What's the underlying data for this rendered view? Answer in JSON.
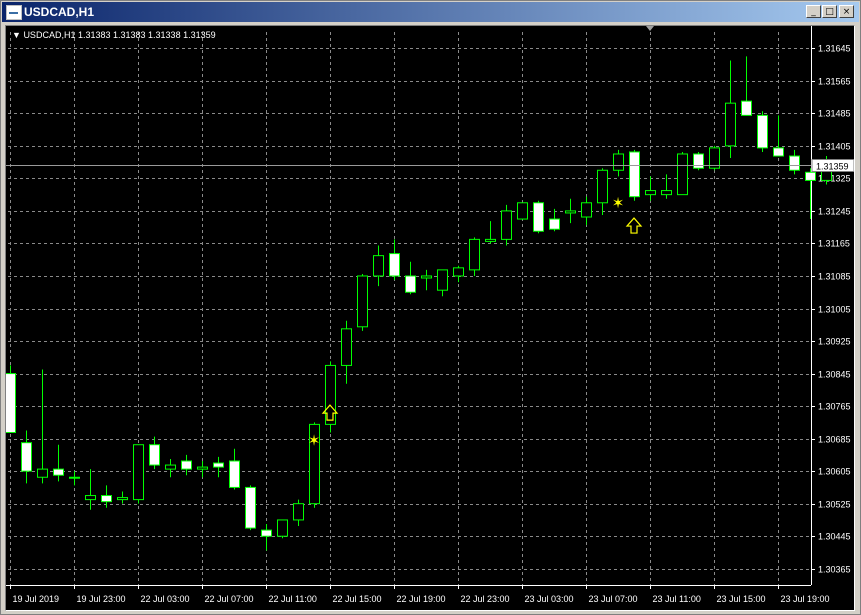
{
  "window": {
    "title": "USDCAD,H1",
    "minimize_glyph": "_",
    "restore_glyph": "□",
    "close_glyph": "×"
  },
  "chart_header": {
    "arrow_glyph": "▼",
    "symbol": "USDCAD,H1",
    "ohlc": "1.31383 1.31383 1.31338 1.31359"
  },
  "colors": {
    "background": "#000000",
    "grid": "#8a8a8a",
    "bull_outline": "#00ff00",
    "bear_fill": "#ffffff",
    "wick": "#00ff00",
    "signal": "#ffff00",
    "axis_text": "#ffffff",
    "price_line": "#9a9a9a"
  },
  "chart_data": {
    "type": "candlestick",
    "symbol": "USDCAD",
    "timeframe": "H1",
    "ylim": [
      1.31365,
      1.30365
    ],
    "y_axis_note": "prices shown on right axis",
    "y_ticks": [
      "1.31645",
      "1.31565",
      "1.31485",
      "1.31405",
      "1.31325",
      "1.31245",
      "1.31165",
      "1.31085",
      "1.31005",
      "1.30925",
      "1.30845",
      "1.30765",
      "1.30685",
      "1.30605",
      "1.30525",
      "1.30445",
      "1.30365"
    ],
    "x_ticks": [
      "19 Jul 2019",
      "19 Jul 23:00",
      "22 Jul 03:00",
      "22 Jul 07:00",
      "22 Jul 11:00",
      "22 Jul 15:00",
      "22 Jul 19:00",
      "22 Jul 23:00",
      "23 Jul 03:00",
      "23 Jul 07:00",
      "23 Jul 11:00",
      "23 Jul 15:00",
      "23 Jul 19:00"
    ],
    "current_price": "1.31359",
    "candles": [
      {
        "o": 1.30845,
        "h": 1.30865,
        "l": 1.307,
        "c": 1.307
      },
      {
        "o": 1.30675,
        "h": 1.30705,
        "l": 1.30575,
        "c": 1.30605
      },
      {
        "o": 1.3059,
        "h": 1.30855,
        "l": 1.30575,
        "c": 1.3061
      },
      {
        "o": 1.3061,
        "h": 1.3067,
        "l": 1.3058,
        "c": 1.30595
      },
      {
        "o": 1.3059,
        "h": 1.30605,
        "l": 1.3057,
        "c": 1.3059
      },
      {
        "o": 1.30535,
        "h": 1.3061,
        "l": 1.3051,
        "c": 1.30545
      },
      {
        "o": 1.30545,
        "h": 1.3057,
        "l": 1.30515,
        "c": 1.3053
      },
      {
        "o": 1.30535,
        "h": 1.30555,
        "l": 1.30525,
        "c": 1.3054
      },
      {
        "o": 1.30535,
        "h": 1.3067,
        "l": 1.30525,
        "c": 1.3067
      },
      {
        "o": 1.3067,
        "h": 1.3069,
        "l": 1.3061,
        "c": 1.3062
      },
      {
        "o": 1.3061,
        "h": 1.30635,
        "l": 1.3059,
        "c": 1.3062
      },
      {
        "o": 1.3063,
        "h": 1.30645,
        "l": 1.30595,
        "c": 1.3061
      },
      {
        "o": 1.3061,
        "h": 1.3063,
        "l": 1.3059,
        "c": 1.30615
      },
      {
        "o": 1.30625,
        "h": 1.3064,
        "l": 1.3059,
        "c": 1.30615
      },
      {
        "o": 1.3063,
        "h": 1.3066,
        "l": 1.3056,
        "c": 1.30565
      },
      {
        "o": 1.30565,
        "h": 1.3057,
        "l": 1.3046,
        "c": 1.30465
      },
      {
        "o": 1.3046,
        "h": 1.30475,
        "l": 1.3041,
        "c": 1.30445
      },
      {
        "o": 1.30445,
        "h": 1.30485,
        "l": 1.3044,
        "c": 1.30485
      },
      {
        "o": 1.30485,
        "h": 1.30535,
        "l": 1.3047,
        "c": 1.30525
      },
      {
        "o": 1.30525,
        "h": 1.30725,
        "l": 1.30515,
        "c": 1.3072
      },
      {
        "o": 1.3072,
        "h": 1.30875,
        "l": 1.307,
        "c": 1.30865
      },
      {
        "o": 1.30865,
        "h": 1.30975,
        "l": 1.3082,
        "c": 1.30955
      },
      {
        "o": 1.3096,
        "h": 1.3109,
        "l": 1.3095,
        "c": 1.31085
      },
      {
        "o": 1.31085,
        "h": 1.3116,
        "l": 1.3106,
        "c": 1.31135
      },
      {
        "o": 1.3114,
        "h": 1.31175,
        "l": 1.31075,
        "c": 1.31085
      },
      {
        "o": 1.31085,
        "h": 1.3112,
        "l": 1.3104,
        "c": 1.31045
      },
      {
        "o": 1.3108,
        "h": 1.311,
        "l": 1.3105,
        "c": 1.31085
      },
      {
        "o": 1.3105,
        "h": 1.311,
        "l": 1.31035,
        "c": 1.311
      },
      {
        "o": 1.31085,
        "h": 1.3111,
        "l": 1.3107,
        "c": 1.31105
      },
      {
        "o": 1.311,
        "h": 1.3118,
        "l": 1.31085,
        "c": 1.31175
      },
      {
        "o": 1.3117,
        "h": 1.3122,
        "l": 1.31165,
        "c": 1.31175
      },
      {
        "o": 1.31175,
        "h": 1.3126,
        "l": 1.3116,
        "c": 1.31245
      },
      {
        "o": 1.31225,
        "h": 1.31265,
        "l": 1.31225,
        "c": 1.31265
      },
      {
        "o": 1.31265,
        "h": 1.3127,
        "l": 1.3119,
        "c": 1.31195
      },
      {
        "o": 1.31225,
        "h": 1.3125,
        "l": 1.31195,
        "c": 1.312
      },
      {
        "o": 1.3124,
        "h": 1.31275,
        "l": 1.31215,
        "c": 1.31245
      },
      {
        "o": 1.3123,
        "h": 1.3128,
        "l": 1.3121,
        "c": 1.31265
      },
      {
        "o": 1.31265,
        "h": 1.3135,
        "l": 1.31235,
        "c": 1.31345
      },
      {
        "o": 1.31345,
        "h": 1.31395,
        "l": 1.3133,
        "c": 1.31385
      },
      {
        "o": 1.3139,
        "h": 1.31395,
        "l": 1.3127,
        "c": 1.3128
      },
      {
        "o": 1.31285,
        "h": 1.3133,
        "l": 1.3127,
        "c": 1.31295
      },
      {
        "o": 1.31285,
        "h": 1.31335,
        "l": 1.31275,
        "c": 1.31295
      },
      {
        "o": 1.31285,
        "h": 1.3139,
        "l": 1.31285,
        "c": 1.31385
      },
      {
        "o": 1.31385,
        "h": 1.3139,
        "l": 1.31345,
        "c": 1.3135
      },
      {
        "o": 1.3135,
        "h": 1.31405,
        "l": 1.31345,
        "c": 1.314
      },
      {
        "o": 1.31405,
        "h": 1.31615,
        "l": 1.31375,
        "c": 1.3151
      },
      {
        "o": 1.31515,
        "h": 1.31625,
        "l": 1.31485,
        "c": 1.3148
      },
      {
        "o": 1.3148,
        "h": 1.3149,
        "l": 1.3139,
        "c": 1.314
      },
      {
        "o": 1.314,
        "h": 1.3148,
        "l": 1.31385,
        "c": 1.3138
      },
      {
        "o": 1.3138,
        "h": 1.31395,
        "l": 1.31335,
        "c": 1.31345
      },
      {
        "o": 1.3134,
        "h": 1.3135,
        "l": 1.31225,
        "c": 1.3132
      },
      {
        "o": 1.3132,
        "h": 1.3138,
        "l": 1.3131,
        "c": 1.3135
      }
    ],
    "signals": [
      {
        "type": "star",
        "index": 19,
        "price": 1.3068
      },
      {
        "type": "up-arrow",
        "index": 20,
        "price": 1.30765
      },
      {
        "type": "star",
        "index": 38,
        "price": 1.31265
      },
      {
        "type": "up-arrow",
        "index": 39,
        "price": 1.31225
      }
    ]
  }
}
